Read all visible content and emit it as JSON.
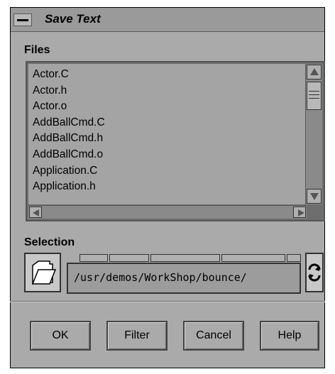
{
  "window": {
    "title": "Save Text"
  },
  "files": {
    "label": "Files",
    "items": [
      "Actor.C",
      "Actor.h",
      "Actor.o",
      "AddBallCmd.C",
      "AddBallCmd.h",
      "AddBallCmd.o",
      "Application.C",
      "Application.h"
    ]
  },
  "selection": {
    "label": "Selection",
    "path": "/usr/demos/WorkShop/bounce/",
    "icons": {
      "folder": "folder-icon",
      "updown": "up-down-arrows-icon"
    }
  },
  "buttons": {
    "ok": "OK",
    "filter": "Filter",
    "cancel": "Cancel",
    "help": "Help"
  },
  "colors": {
    "background": "#aaaaaa",
    "list_bg": "#a4a4a4",
    "titlebar": "#9a9a9a"
  }
}
